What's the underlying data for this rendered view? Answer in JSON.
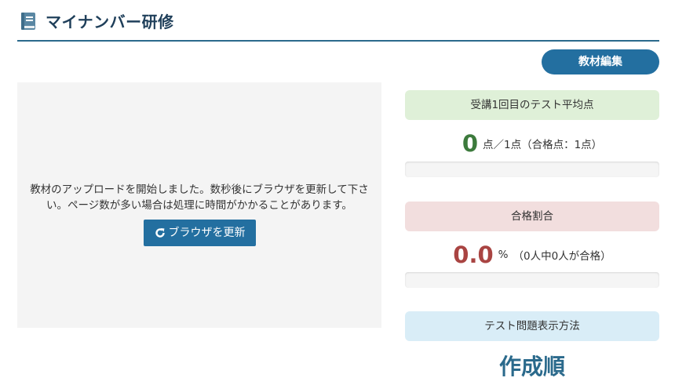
{
  "header": {
    "title": "マイナンバー研修",
    "icon": "book-icon"
  },
  "toolbar": {
    "edit_label": "教材編集"
  },
  "upload": {
    "message": "教材のアップロードを開始しました。数秒後にブラウザを更新して下さい。ページ数が多い場合は処理に時間がかかることがあります。",
    "reload_label": "ブラウザを更新",
    "reload_icon": "refresh-icon"
  },
  "stats": {
    "average": {
      "heading": "受講1回目のテスト平均点",
      "value": "0",
      "detail": "点／1点（合格点：1点）",
      "progress": 0
    },
    "pass_rate": {
      "heading": "合格割合",
      "value": "0.0",
      "unit": "%",
      "detail": "（0人中0人が合格）",
      "progress": 0
    },
    "display_method": {
      "heading": "テスト問題表示方法",
      "value": "作成順"
    }
  },
  "colors": {
    "accent": "#236fa0",
    "green": "#3c7a3c",
    "red": "#a94442",
    "title": "#1f3f5a"
  }
}
